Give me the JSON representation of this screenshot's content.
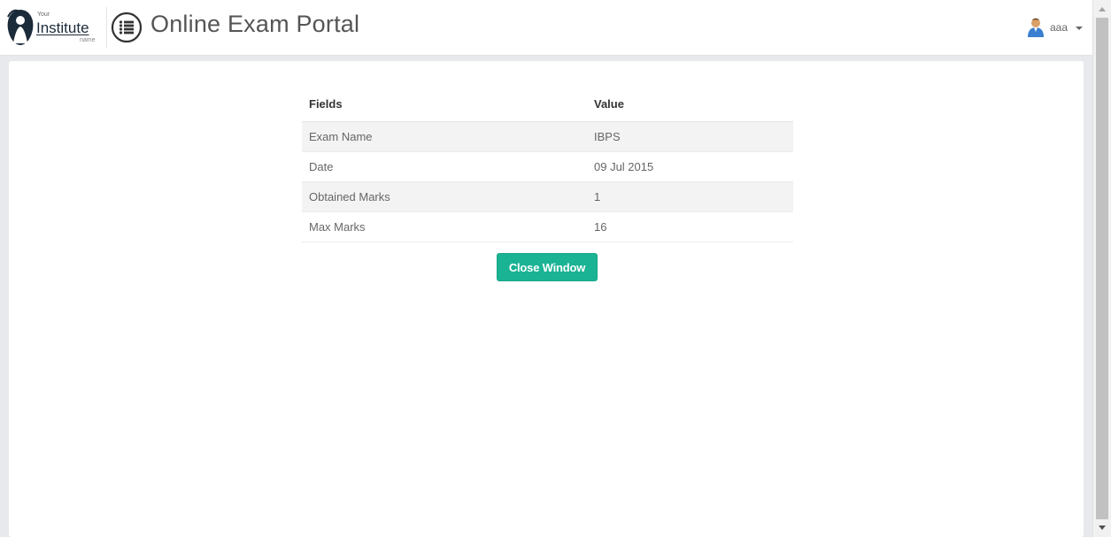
{
  "header": {
    "logo_small_top": "Your",
    "logo_main": "Institute",
    "logo_small_bottom": "name",
    "menu_icon": "list-icon",
    "title": "Online Exam Portal",
    "user": {
      "icon": "user-icon",
      "name": "aaa"
    }
  },
  "result_table": {
    "headers": {
      "field": "Fields",
      "value": "Value"
    },
    "rows": [
      {
        "field": "Exam Name",
        "value": "IBPS"
      },
      {
        "field": "Date",
        "value": "09 Jul 2015"
      },
      {
        "field": "Obtained Marks",
        "value": "1"
      },
      {
        "field": "Max Marks",
        "value": "16"
      }
    ]
  },
  "actions": {
    "close_label": "Close Window"
  },
  "colors": {
    "accent": "#1ab394",
    "background": "#e7e9ec",
    "title": "#555555"
  }
}
